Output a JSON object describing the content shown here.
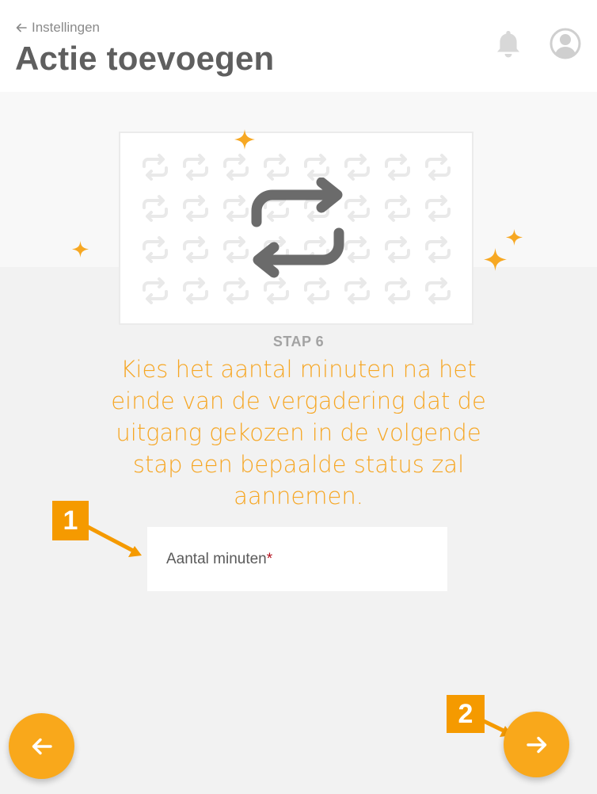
{
  "header": {
    "back_label": "Instellingen",
    "title": "Actie toevoegen"
  },
  "step": {
    "label": "STAP 6",
    "description": "Kies het aantal minuten na het einde van de vergadering dat de uitgang gekozen in de volgende stap een bepaalde status zal aannemen."
  },
  "form": {
    "minutes_label": "Aantal minuten",
    "required_marker": "*"
  },
  "annotations": {
    "first": "1",
    "second": "2"
  },
  "icons": {
    "back": "arrow-left-icon",
    "bell": "bell-icon",
    "account": "user-circle-icon",
    "hero": "repeat-icon",
    "previous": "arrow-left-icon",
    "next": "arrow-right-icon"
  },
  "colors": {
    "accent": "#f9a81b",
    "description_text": "#f6a623",
    "annotation": "#f59a00",
    "required": "#b30e1c"
  }
}
